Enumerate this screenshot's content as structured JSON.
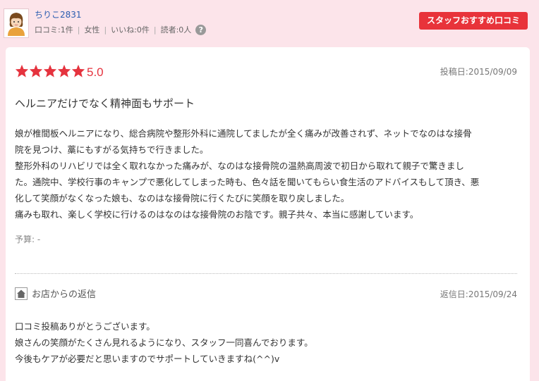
{
  "user": {
    "name": "ちりこ2831",
    "stats": [
      "口コミ:1件",
      "女性",
      "いいね:0件",
      "読者:0人"
    ],
    "separator": "|",
    "help_icon": "?"
  },
  "header": {
    "staff_button": "スタッフおすすめ口コミ"
  },
  "review": {
    "stars": 5,
    "score": "5.0",
    "posted_date": "投稿日:2015/09/09",
    "title": "ヘルニアだけでなく精神面もサポート",
    "body_lines": [
      "娘が椎間板ヘルニアになり、総合病院や整形外科に通院してましたが全く痛みが改善されず、ネットでなのはな接骨",
      "院を見つけ、藁にもすがる気持ちで行きました。",
      "整形外科のリハビリでは全く取れなかった痛みが、なのはな接骨院の温熱高周波で初日から取れて親子で驚きまし",
      "た。通院中、学校行事のキャンプで悪化してしまった時も、色々話を聞いてもらい食生活のアドバイスもして頂き、悪",
      "化して笑顔がなくなった娘も、なのはな接骨院に行くたびに笑顔を取り戻しました。",
      "痛みも取れ、楽しく学校に行けるのはなのはな接骨院のお陰です。親子共々、本当に感謝しています。"
    ],
    "budget": "予算: -"
  },
  "reply": {
    "label": "お店からの返信",
    "date": "返信日:2015/09/24",
    "lines": [
      "口コミ投稿ありがとうございます。",
      "娘さんの笑顔がたくさん見れるようになり、スタッフ一同喜んでおります。",
      "今後もケアが必要だと思いますのでサポートしていきますね(^^)v"
    ]
  },
  "colors": {
    "accent": "#e5333e",
    "background": "#fce4ea",
    "link": "#2a5db0"
  },
  "icons": {
    "avatar": "user-avatar-illustration",
    "reply": "house-icon"
  }
}
